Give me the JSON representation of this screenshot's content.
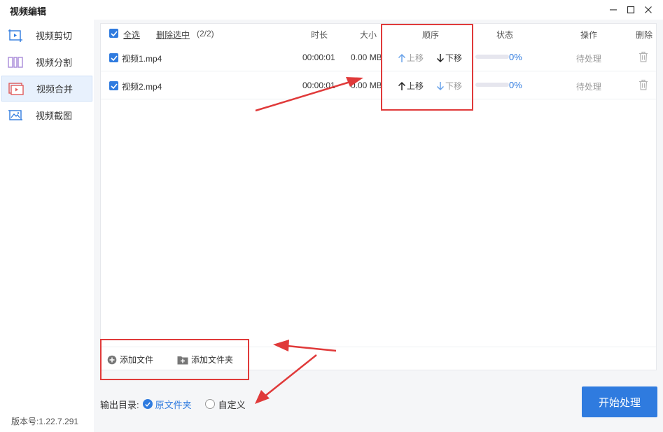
{
  "window": {
    "title": "视频编辑"
  },
  "sidebar": {
    "items": [
      {
        "label": "视频剪切",
        "icon": "video-cut-icon"
      },
      {
        "label": "视频分割",
        "icon": "video-split-icon"
      },
      {
        "label": "视频合并",
        "icon": "video-merge-icon",
        "active": true
      },
      {
        "label": "视频截图",
        "icon": "video-screenshot-icon"
      }
    ],
    "version": "版本号:1.22.7.291"
  },
  "table": {
    "select_all": "全选",
    "delete_selected": "删除选中",
    "count": "(2/2)",
    "headers": {
      "duration": "时长",
      "size": "大小",
      "order": "顺序",
      "status": "状态",
      "action": "操作",
      "delete": "删除"
    },
    "rows": [
      {
        "name": "视频1.mp4",
        "duration": "00:00:01",
        "size": "0.00 MB",
        "up": "上移",
        "down": "下移",
        "progress": 0,
        "percent": "0%",
        "action": "待处理",
        "up_enabled": false,
        "down_enabled": true
      },
      {
        "name": "视频2.mp4",
        "duration": "00:00:01",
        "size": "0.00 MB",
        "up": "上移",
        "down": "下移",
        "progress": 0,
        "percent": "0%",
        "action": "待处理",
        "up_enabled": true,
        "down_enabled": false
      }
    ]
  },
  "add": {
    "file": "添加文件",
    "folder": "添加文件夹"
  },
  "output": {
    "label": "输出目录:",
    "option_original": "原文件夹",
    "option_custom": "自定义",
    "selected": "原文件夹"
  },
  "start_button": "开始处理",
  "colors": {
    "accent": "#2f7bdf",
    "annotation": "#e03a3a"
  }
}
